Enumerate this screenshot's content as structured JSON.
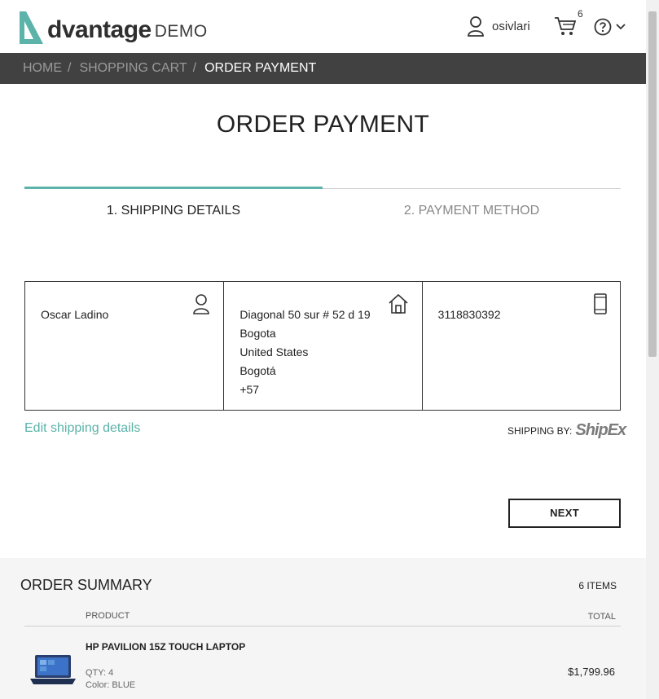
{
  "header": {
    "logo_word": "dvantage",
    "logo_demo": "DEMO",
    "username": "osivlari",
    "cart_count": "6"
  },
  "breadcrumb": {
    "home": "HOME",
    "cart": "SHOPPING CART",
    "current": "ORDER PAYMENT",
    "separator": "/"
  },
  "page": {
    "title": "ORDER PAYMENT"
  },
  "steps": [
    {
      "label": "1. SHIPPING DETAILS",
      "active": true
    },
    {
      "label": "2. PAYMENT METHOD",
      "active": false
    }
  ],
  "shipping": {
    "name": "Oscar Ladino",
    "address_lines": [
      "Diagonal 50 sur # 52 d 19",
      "Bogota",
      "United States",
      "Bogotá",
      "+57"
    ],
    "phone": "3118830392",
    "edit_link": "Edit shipping details",
    "shipping_by_label": "SHIPPING BY:",
    "shipping_brand": "ShipEx"
  },
  "actions": {
    "next_label": "NEXT"
  },
  "summary": {
    "title": "ORDER SUMMARY",
    "items_count": "6 ITEMS",
    "col_product": "PRODUCT",
    "col_total": "TOTAL",
    "items": [
      {
        "name": "HP PAVILION 15Z TOUCH LAPTOP",
        "qty": "QTY: 4",
        "color": "Color: BLUE",
        "price": "$1,799.96"
      }
    ]
  },
  "colors": {
    "accent": "#5bb3a9",
    "breadcrumb_bg": "#414141",
    "summary_bg": "#f5f5f5"
  }
}
